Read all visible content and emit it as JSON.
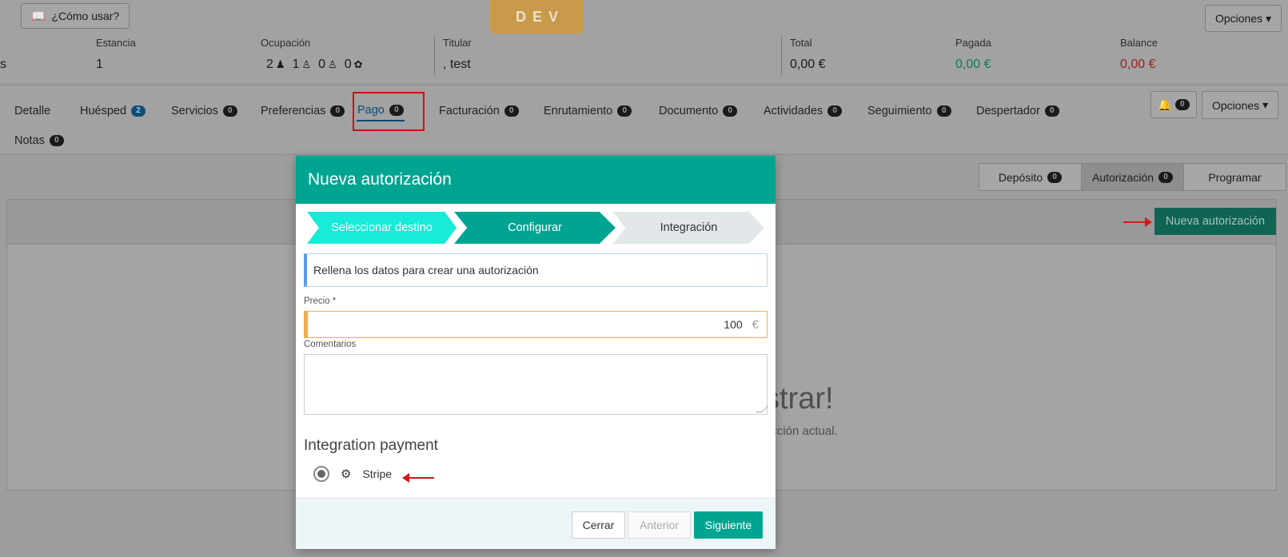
{
  "header": {
    "help_label": "¿Cómo usar?",
    "dev_badge": "DEV",
    "options_label": "Opciones"
  },
  "stats": {
    "left_fragment": "s",
    "stay_label": "Estancia",
    "stay_value": "1",
    "occupancy_label": "Ocupación",
    "occupancy": {
      "adults": "2",
      "children": "1",
      "juniors": "0",
      "babies": "0"
    },
    "holder_label": "Titular",
    "holder_value": ", test",
    "total_label": "Total",
    "total_value": "0,00 €",
    "paid_label": "Pagada",
    "paid_value": "0,00 €",
    "balance_label": "Balance",
    "balance_value": "0,00 €"
  },
  "tabs": [
    {
      "label": "Detalle",
      "count": ""
    },
    {
      "label": "Huésped",
      "count": "2"
    },
    {
      "label": "Servicios",
      "count": "0"
    },
    {
      "label": "Preferencias",
      "count": "0"
    },
    {
      "label": "Pago",
      "count": "0"
    },
    {
      "label": "Facturación",
      "count": "0"
    },
    {
      "label": "Enrutamiento",
      "count": "0"
    },
    {
      "label": "Documento",
      "count": "0"
    },
    {
      "label": "Actividades",
      "count": "0"
    },
    {
      "label": "Seguimiento",
      "count": "0"
    },
    {
      "label": "Despertador",
      "count": "0"
    },
    {
      "label": "Notas",
      "count": "0"
    }
  ],
  "tab_tools": {
    "bell_count": "0",
    "options_label": "Opciones"
  },
  "subtabs": [
    {
      "label": "Depósito",
      "count": "0"
    },
    {
      "label": "Autorización",
      "count": "0"
    },
    {
      "label": "Programar",
      "count": ""
    }
  ],
  "panel": {
    "new_auth_label": "Nueva autorización",
    "empty_title": "strar!",
    "empty_sub": "ección actual."
  },
  "modal": {
    "title": "Nueva autorización",
    "steps": [
      "Seleccionar destino",
      "Configurar",
      "Integración"
    ],
    "info": "Rellena los datos para crear una autorización",
    "price_label": "Precio *",
    "price_value": "100",
    "currency": "€",
    "comments_label": "Comentarios",
    "integration_title": "Integration payment",
    "integration_option": "Stripe",
    "buttons": {
      "close": "Cerrar",
      "prev": "Anterior",
      "next": "Siguiente"
    }
  }
}
